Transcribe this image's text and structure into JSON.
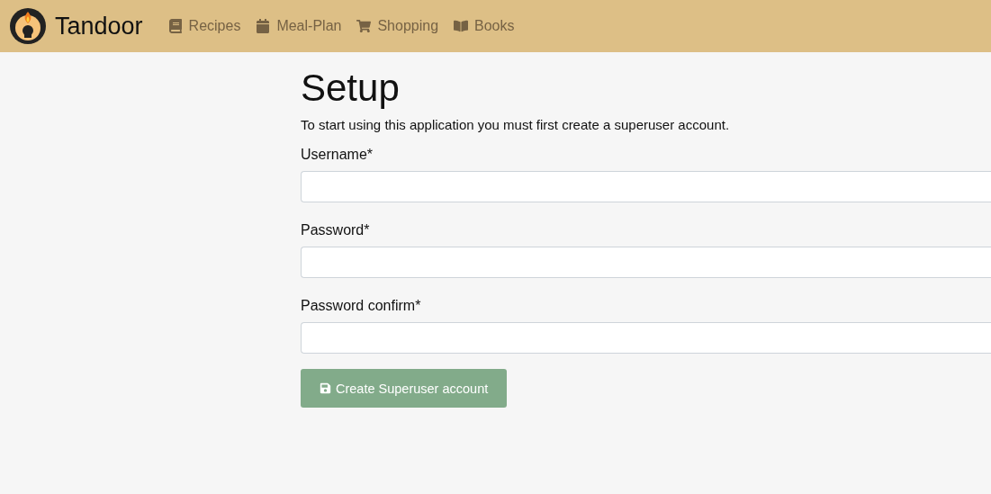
{
  "navbar": {
    "brand": "Tandoor",
    "items": [
      {
        "label": "Recipes"
      },
      {
        "label": "Meal-Plan"
      },
      {
        "label": "Shopping"
      },
      {
        "label": "Books"
      }
    ]
  },
  "page": {
    "title": "Setup",
    "intro": "To start using this application you must first create a superuser account.",
    "fields": [
      {
        "label": "Username*"
      },
      {
        "label": "Password*"
      },
      {
        "label": "Password confirm*"
      }
    ],
    "submit": "Create Superuser account"
  }
}
